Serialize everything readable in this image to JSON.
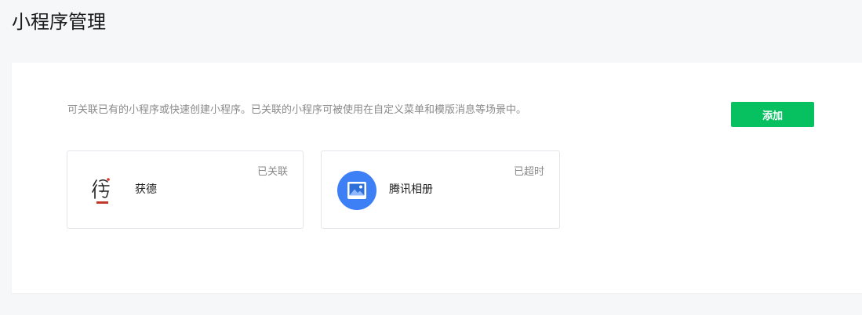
{
  "header": {
    "title": "小程序管理"
  },
  "panel": {
    "description": "可关联已有的小程序或快速创建小程序。已关联的小程序可被使用在自定义菜单和模版消息等场景中。",
    "add_label": "添加",
    "cards": [
      {
        "name": "获德",
        "status": "已关联",
        "avatar_icon": "calligraphy-logo-icon"
      },
      {
        "name": "腾讯相册",
        "status": "已超时",
        "avatar_icon": "photo-album-icon"
      }
    ]
  },
  "colors": {
    "accent": "#07c160",
    "background": "#f6f7f9",
    "muted_text": "#8a8a8a",
    "album_blue": "#3d7ff5"
  }
}
